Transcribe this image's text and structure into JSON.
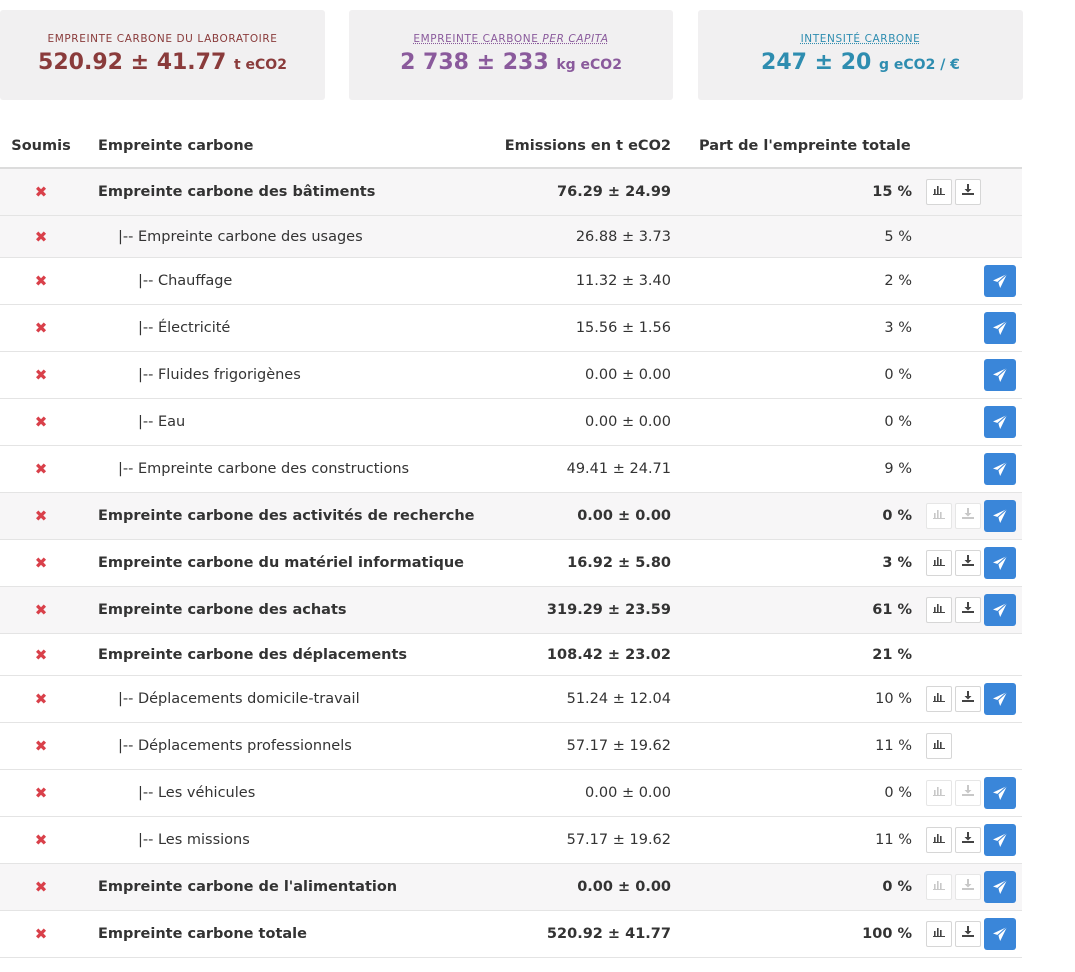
{
  "cards": [
    {
      "label": "EMPREINTE CARBONE DU LABORATOIRE",
      "label_italic": "",
      "value": "520.92 ± 41.77",
      "unit": "t eCO2"
    },
    {
      "label": "EMPREINTE CARBONE",
      "label_italic": "PER CAPITA",
      "value": "2 738 ± 233",
      "unit": "kg eCO2"
    },
    {
      "label": "INTENSITÉ CARBONE",
      "label_italic": "",
      "value": "247 ± 20",
      "unit": "g eCO2 / €"
    }
  ],
  "table": {
    "headers": {
      "submitted": "Soumis",
      "name": "Empreinte carbone",
      "emissions": "Emissions en t eCO2",
      "share": "Part de l'empreinte totale"
    },
    "rows": [
      {
        "name": "Empreinte carbone des bâtiments",
        "emissions": "76.29 ± 24.99",
        "share": "15 %"
      },
      {
        "name": "|-- Empreinte carbone des usages",
        "emissions": "26.88 ± 3.73",
        "share": "5 %"
      },
      {
        "name": "|-- Chauffage",
        "emissions": "11.32 ± 3.40",
        "share": "2 %"
      },
      {
        "name": "|-- Électricité",
        "emissions": "15.56 ± 1.56",
        "share": "3 %"
      },
      {
        "name": "|-- Fluides frigorigènes",
        "emissions": "0.00 ± 0.00",
        "share": "0 %"
      },
      {
        "name": "|-- Eau",
        "emissions": "0.00 ± 0.00",
        "share": "0 %"
      },
      {
        "name": "|-- Empreinte carbone des constructions",
        "emissions": "49.41 ± 24.71",
        "share": "9 %"
      },
      {
        "name": "Empreinte carbone des activités de recherche",
        "emissions": "0.00 ± 0.00",
        "share": "0 %"
      },
      {
        "name": "Empreinte carbone du matériel informatique",
        "emissions": "16.92 ± 5.80",
        "share": "3 %"
      },
      {
        "name": "Empreinte carbone des achats",
        "emissions": "319.29 ± 23.59",
        "share": "61 %"
      },
      {
        "name": "Empreinte carbone des déplacements",
        "emissions": "108.42 ± 23.02",
        "share": "21 %"
      },
      {
        "name": "|-- Déplacements domicile-travail",
        "emissions": "51.24 ± 12.04",
        "share": "10 %"
      },
      {
        "name": "|-- Déplacements professionnels",
        "emissions": "57.17 ± 19.62",
        "share": "11 %"
      },
      {
        "name": "|-- Les véhicules",
        "emissions": "0.00 ± 0.00",
        "share": "0 %"
      },
      {
        "name": "|-- Les missions",
        "emissions": "57.17 ± 19.62",
        "share": "11 %"
      },
      {
        "name": "Empreinte carbone de l'alimentation",
        "emissions": "0.00 ± 0.00",
        "share": "0 %"
      },
      {
        "name": "Empreinte carbone totale",
        "emissions": "520.92 ± 41.77",
        "share": "100 %"
      }
    ]
  },
  "icons": {
    "not_submitted": "✖",
    "chart": "chart-icon",
    "download": "download-icon",
    "send": "send-icon"
  },
  "colors": {
    "lab": "#8a3b3b",
    "per_capita": "#8a5a9c",
    "intensity": "#2e8db0",
    "not_submitted": "#d9404a",
    "send_button": "#3a86d9"
  }
}
